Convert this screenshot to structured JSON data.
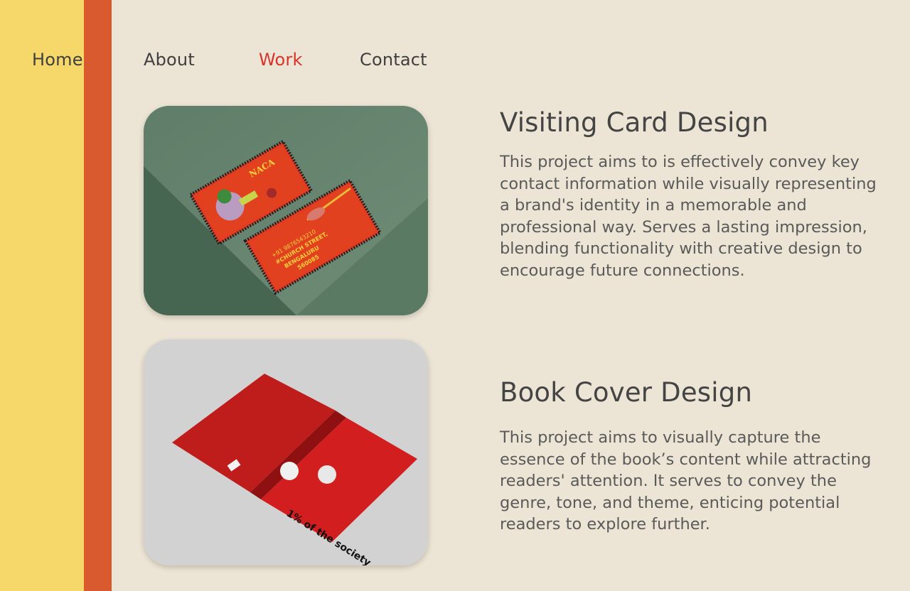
{
  "nav": {
    "items": [
      {
        "label": "Home"
      },
      {
        "label": "About"
      },
      {
        "label": "Work"
      },
      {
        "label": "Contact"
      }
    ],
    "active": "Work"
  },
  "colors": {
    "background": "#ece4d4",
    "stripe_yellow": "#f5d76a",
    "stripe_orange": "#d95a2f",
    "nav_active": "#d8342a"
  },
  "projects": [
    {
      "title": "Visiting Card Design",
      "description": "This project aims to is effectively convey key contact information while visually representing a brand's identity in a memorable and professional way. Serves a lasting impression, blending functionality with creative design to encourage future connections.",
      "image": {
        "subject": "business-card-mockup",
        "front_title": "NACA",
        "back_lines": [
          "+91 9876543210",
          "#CHURCH STREET,",
          "BENGALURU",
          "560085"
        ]
      }
    },
    {
      "title": "Book Cover Design",
      "description": "This project aims to visually capture the essence of the book’s content while attracting readers' attention. It serves to convey the genre, tone, and theme, enticing potential readers to explore further.",
      "image": {
        "subject": "book-cover-mockup",
        "cover_text": "1% of the society"
      }
    }
  ]
}
